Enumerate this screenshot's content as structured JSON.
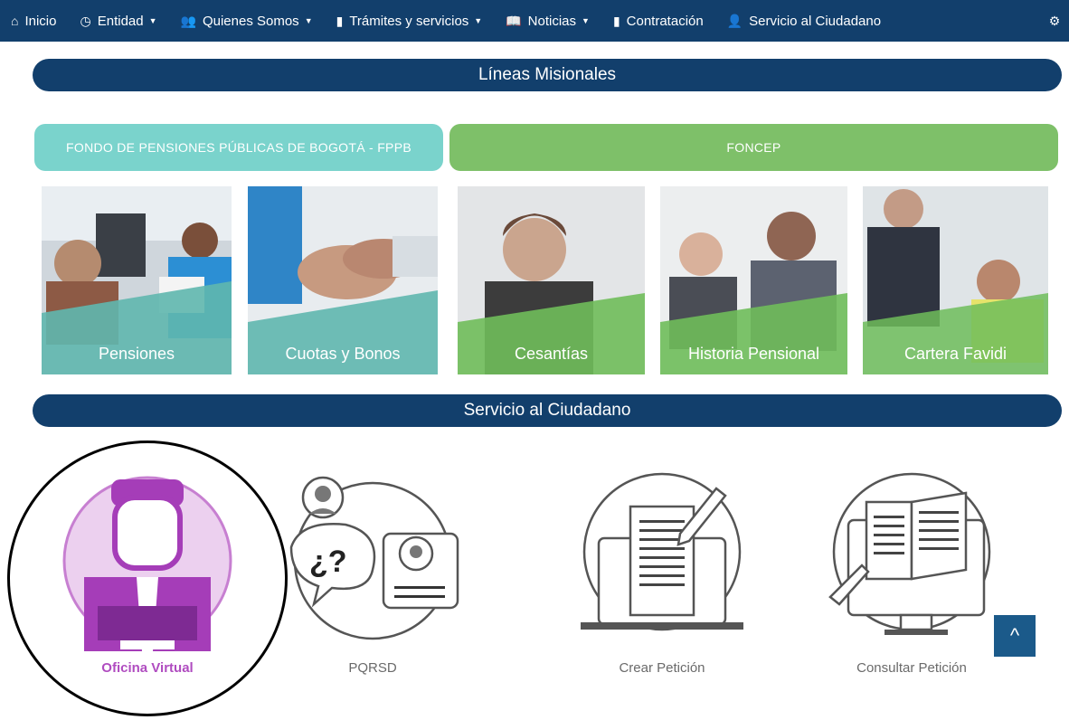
{
  "nav": {
    "items": [
      {
        "icon": "home-icon",
        "glyph": "⌂",
        "label": "Inicio",
        "dropdown": false
      },
      {
        "icon": "clock-icon",
        "glyph": "◷",
        "label": "Entidad",
        "dropdown": true
      },
      {
        "icon": "users-icon",
        "glyph": "👥",
        "label": "Quienes Somos",
        "dropdown": true
      },
      {
        "icon": "document-icon",
        "glyph": "▮",
        "label": "Trámites y servicios",
        "dropdown": true
      },
      {
        "icon": "book-icon",
        "glyph": "📖",
        "label": "Noticias",
        "dropdown": true
      },
      {
        "icon": "document-icon",
        "glyph": "▮",
        "label": "Contratación",
        "dropdown": false
      },
      {
        "icon": "user-icon",
        "glyph": "👤",
        "label": "Servicio al Ciudadano",
        "dropdown": false
      }
    ]
  },
  "lineas": {
    "title": "Líneas Misionales",
    "tab_fppb": "FONDO DE PENSIONES PÚBLICAS DE BOGOTÁ - FPPB",
    "tab_foncep": "FONCEP",
    "cards": [
      {
        "label": "Pensiones"
      },
      {
        "label": "Cuotas y Bonos"
      },
      {
        "label": "Cesantías"
      },
      {
        "label": "Historia Pensional"
      },
      {
        "label": "Cartera Favidi"
      }
    ]
  },
  "servicio": {
    "title": "Servicio al Ciudadano",
    "items": [
      {
        "label": "Oficina Virtual"
      },
      {
        "label": "PQRSD"
      },
      {
        "label": "Crear Petición"
      },
      {
        "label": "Consultar Petición"
      }
    ]
  },
  "colors": {
    "navy": "#123f6c",
    "teal": "#7ad3cc",
    "green": "#7ec069",
    "magenta": "#b04cc0"
  },
  "back_to_top": "^"
}
